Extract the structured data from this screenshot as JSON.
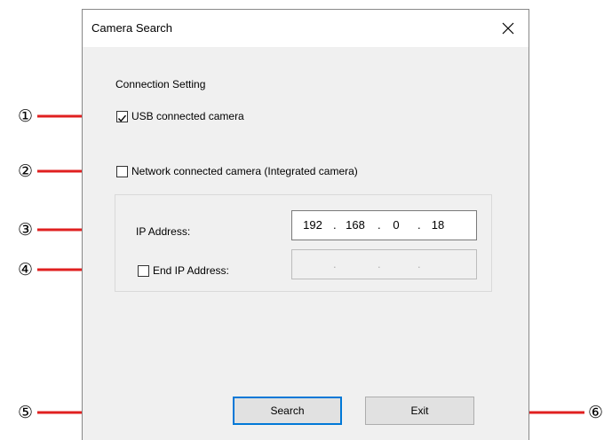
{
  "window": {
    "title": "Camera Search",
    "close_symbol": "✕"
  },
  "connection": {
    "section_label": "Connection Setting",
    "usb": {
      "label": "USB connected camera",
      "checked": true
    },
    "network": {
      "label": "Network connected camera (Integrated camera)",
      "checked": false
    }
  },
  "ip": {
    "label": "IP Address:",
    "octets": [
      "192",
      "168",
      "0",
      "18"
    ],
    "dot": "."
  },
  "end_ip": {
    "label": "End IP Address:",
    "checked": false,
    "octets": [
      "",
      "",
      "",
      ""
    ],
    "dot": "."
  },
  "buttons": {
    "search": "Search",
    "exit": "Exit"
  },
  "callouts": [
    "①",
    "②",
    "③",
    "④",
    "⑤",
    "⑥"
  ],
  "colors": {
    "callout_line": "#e02020",
    "default_button_border": "#0078d7",
    "dialog_bg": "#f0f0f0"
  }
}
